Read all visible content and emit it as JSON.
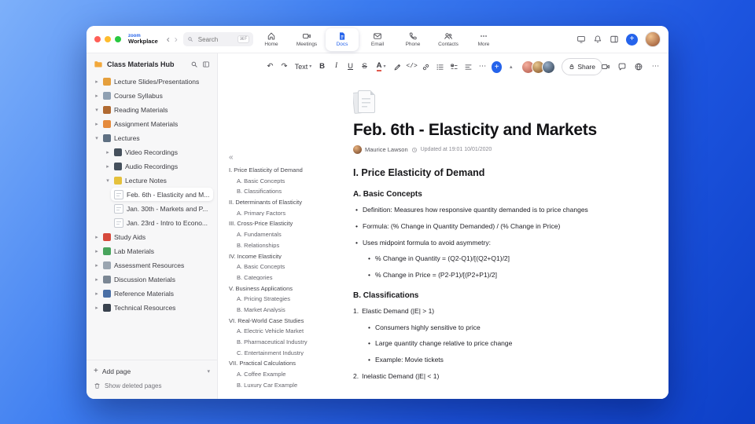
{
  "colors": {
    "accent": "#2563eb",
    "window_bg": "#ffffff",
    "sidebar_bg": "#f7f7f8"
  },
  "icons": {
    "undo": "↶",
    "redo": "↷",
    "more_h": "⋯",
    "collapse_outline": "«",
    "collapse_up": "▴",
    "chevron_down": "▾",
    "back": "‹",
    "forward": "›",
    "plus": "+"
  },
  "titlebar": {
    "brand_top": "zoom",
    "brand_bottom": "Workplace",
    "search_placeholder": "Search",
    "search_shortcut": "⌘F",
    "tabs": [
      {
        "label": "Home",
        "active": false
      },
      {
        "label": "Meetings",
        "active": false
      },
      {
        "label": "Docs",
        "active": true
      },
      {
        "label": "Email",
        "active": false
      },
      {
        "label": "Phone",
        "active": false
      },
      {
        "label": "Contacts",
        "active": false
      },
      {
        "label": "More",
        "active": false
      }
    ]
  },
  "sidebar": {
    "title": "Class Materials Hub",
    "items": [
      {
        "label": "Lecture Slides/Presentations",
        "level": 0,
        "icon": "presentation-icon"
      },
      {
        "label": "Course Syllabus",
        "level": 0,
        "icon": "syllabus-icon"
      },
      {
        "label": "Reading Materials",
        "level": 0,
        "icon": "book-icon",
        "expanded": true
      },
      {
        "label": "Assignment Materials",
        "level": 0,
        "icon": "assignment-icon"
      },
      {
        "label": "Lectures",
        "level": 0,
        "icon": "lectures-icon",
        "expanded": true
      },
      {
        "label": "Video Recordings",
        "level": 1,
        "icon": "video-icon"
      },
      {
        "label": "Audio Recordings",
        "level": 1,
        "icon": "audio-icon"
      },
      {
        "label": "Lecture Notes",
        "level": 1,
        "icon": "notes-icon",
        "expanded": true
      },
      {
        "label": "Feb. 6th - Elasticity and M...",
        "level": 2,
        "icon": "page-icon",
        "selected": true
      },
      {
        "label": "Jan. 30th - Markets and P...",
        "level": 2,
        "icon": "page-icon"
      },
      {
        "label": "Jan. 23rd - Intro to Econo...",
        "level": 2,
        "icon": "page-icon"
      },
      {
        "label": "Study Aids",
        "level": 0,
        "icon": "study-icon"
      },
      {
        "label": "Lab Materials",
        "level": 0,
        "icon": "lab-icon"
      },
      {
        "label": "Assessment Resources",
        "level": 0,
        "icon": "assessment-icon"
      },
      {
        "label": "Discussion Materials",
        "level": 0,
        "icon": "discussion-icon"
      },
      {
        "label": "Reference Materials",
        "level": 0,
        "icon": "reference-icon"
      },
      {
        "label": "Technical Resources",
        "level": 0,
        "icon": "technical-icon"
      }
    ],
    "add_page": "Add page",
    "show_deleted": "Show deleted pages"
  },
  "toolbar": {
    "text_style": "Text",
    "bold": "B",
    "italic": "I",
    "underline": "U",
    "strike": "S",
    "color": "A",
    "code": "</>",
    "share": "Share"
  },
  "outline": {
    "items": [
      {
        "label": "I. Price Elasticity of Demand",
        "level": 0
      },
      {
        "label": "A. Basic Concepts",
        "level": 1
      },
      {
        "label": "B. Classifications",
        "level": 1
      },
      {
        "label": "II. Determinants of Elasticity",
        "level": 0
      },
      {
        "label": "A. Primary Factors",
        "level": 1
      },
      {
        "label": "III. Cross-Price Elasticity",
        "level": 0
      },
      {
        "label": "A. Fundamentals",
        "level": 1
      },
      {
        "label": "B. Relationships",
        "level": 1
      },
      {
        "label": "IV. Income Elasticity",
        "level": 0
      },
      {
        "label": "A. Basic Concepts",
        "level": 1
      },
      {
        "label": "B. Categories",
        "level": 1
      },
      {
        "label": "V. Business Applications",
        "level": 0
      },
      {
        "label": "A. Pricing Strategies",
        "level": 1
      },
      {
        "label": "B. Market Analysis",
        "level": 1
      },
      {
        "label": "VI. Real-World Case Studies",
        "level": 0
      },
      {
        "label": "A. Electric Vehicle Market",
        "level": 1
      },
      {
        "label": "B. Pharmaceutical Industry",
        "level": 1
      },
      {
        "label": "C. Entertainment Industry",
        "level": 1
      },
      {
        "label": "VII. Practical Calculations",
        "level": 0
      },
      {
        "label": "A. Coffee Example",
        "level": 1
      },
      {
        "label": "B. Luxury Car Example",
        "level": 1
      }
    ]
  },
  "doc": {
    "title": "Feb. 6th - Elasticity and Markets",
    "author": "Maurice Lawson",
    "updated": "Updated at 19:01 10/01/2020",
    "h1": "I. Price Elasticity of Demand",
    "h2a": "A. Basic Concepts",
    "a_bullets": [
      "Definition: Measures how responsive quantity demanded is to price changes",
      "Formula: (% Change in Quantity Demanded) / (% Change in Price)",
      "Uses midpoint formula to avoid asymmetry:"
    ],
    "a_sub": [
      "% Change in Quantity = (Q2-Q1)/[(Q2+Q1)/2]",
      "% Change in Price = (P2-P1)/[(P2+P1)/2]"
    ],
    "h2b": "B. Classifications",
    "b1_num": "1.",
    "b1": "Elastic Demand (|E| > 1)",
    "b1_bullets": [
      "Consumers highly sensitive to price",
      "Large quantity change relative to price change",
      "Example: Movie tickets"
    ],
    "b2_num": "2.",
    "b2": "Inelastic Demand (|E| < 1)"
  }
}
